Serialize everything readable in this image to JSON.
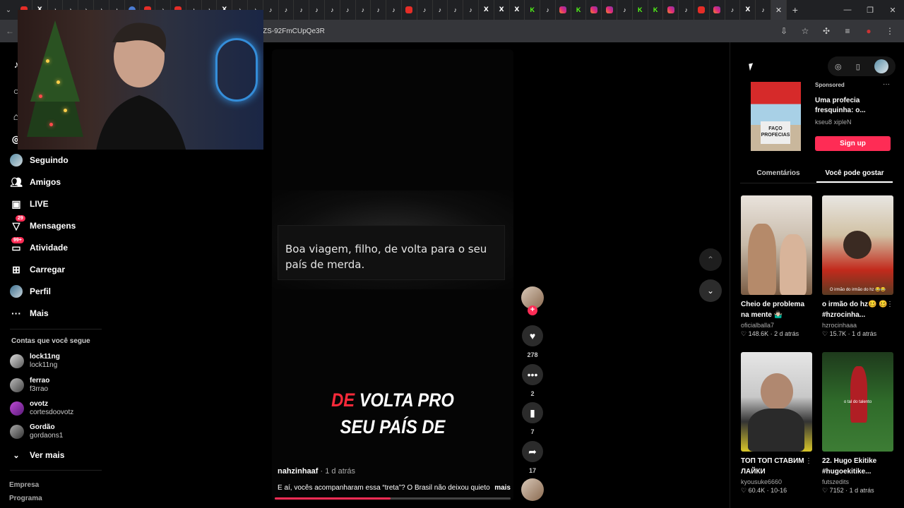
{
  "browser": {
    "tabs": [
      "yt",
      "x",
      "tt",
      "tt",
      "tt",
      "tt",
      "tt",
      "generic",
      "yt",
      "tt",
      "yt",
      "tt",
      "tt",
      "x",
      "tt",
      "tt",
      "tt",
      "tt",
      "tt",
      "tt",
      "tt",
      "tt",
      "tt",
      "tt",
      "tt",
      "yt",
      "tt",
      "tt",
      "tt",
      "tt",
      "x",
      "x",
      "x",
      "kick",
      "tt",
      "ig",
      "kick",
      "ig",
      "ig",
      "tt",
      "kick",
      "kick",
      "ig",
      "tt",
      "yt",
      "ig",
      "tt",
      "x",
      "tt"
    ],
    "url": "ZS-92FmCUpQe3R"
  },
  "sidebar": {
    "items": [
      {
        "label": "Seguindo",
        "icon": "avatar-icon"
      },
      {
        "label": "Amigos",
        "icon": "friends-icon"
      },
      {
        "label": "LIVE",
        "icon": "live-icon"
      },
      {
        "label": "Mensagens",
        "icon": "messages-icon",
        "badge": "29"
      },
      {
        "label": "Atividade",
        "icon": "activity-icon",
        "badge": "99+"
      },
      {
        "label": "Carregar",
        "icon": "upload-icon"
      },
      {
        "label": "Perfil",
        "icon": "profile-icon"
      },
      {
        "label": "Mais",
        "icon": "more-icon"
      }
    ],
    "following_heading": "Contas que você segue",
    "following": [
      {
        "name": "lock11ng",
        "handle": "lock11ng"
      },
      {
        "name": "ferrao",
        "handle": "f3rrao"
      },
      {
        "name": "ovotz",
        "handle": "cortesdoovotz"
      },
      {
        "name": "Gordão",
        "handle": "gordaons1"
      }
    ],
    "see_more": "Ver mais",
    "footer": [
      "Empresa",
      "Programa"
    ]
  },
  "video": {
    "caption": "Boa viagem, filho, de volta para o seu país de merda.",
    "overlay_red": "DE",
    "overlay_line1_rest": " VOLTA PRO",
    "overlay_line2": "SEU PAÍS DE",
    "author": "nahzinhaaf",
    "time": "· 1 d atrás",
    "description": "E aí, vocês acompanharam essa “treta”? O Brasil não deixou quieto",
    "more": "mais",
    "progress": 0.49
  },
  "actions": {
    "likes": "278",
    "comments": "2",
    "saves": "7",
    "shares": "17"
  },
  "ad": {
    "sponsored": "Sponsored",
    "title": "Uma profecia fresquinha: o...",
    "brand": "kseu8 xipleN",
    "cta": "Sign up",
    "sign_text": "FAÇO PROFECIAS"
  },
  "right_tabs": [
    "Comentários",
    "Você pode gostar"
  ],
  "recommended": [
    {
      "title": "Cheio de problema na mente 🤷🏻‍♂️",
      "author": "oficialballa7",
      "likes": "148.6K",
      "time": "2 d atrás"
    },
    {
      "title": "o irmão do hz🥴 🥴 #hzrocinha...",
      "author": "hzrocinhaaa",
      "likes": "15.7K",
      "time": "1 d atrás",
      "overlay": "O irmão do irmão do hz 😂😂"
    },
    {
      "title": "ТОП ТОП СТАВИМ ЛАЙКИ",
      "author": "kyousuke6660",
      "likes": "60.4K",
      "time": "10-16"
    },
    {
      "title": "22. Hugo Ekitike #hugoekitike...",
      "author": "futszedits",
      "likes": "7152",
      "time": "1 d atrás",
      "overlay": "o tal do talento"
    }
  ]
}
